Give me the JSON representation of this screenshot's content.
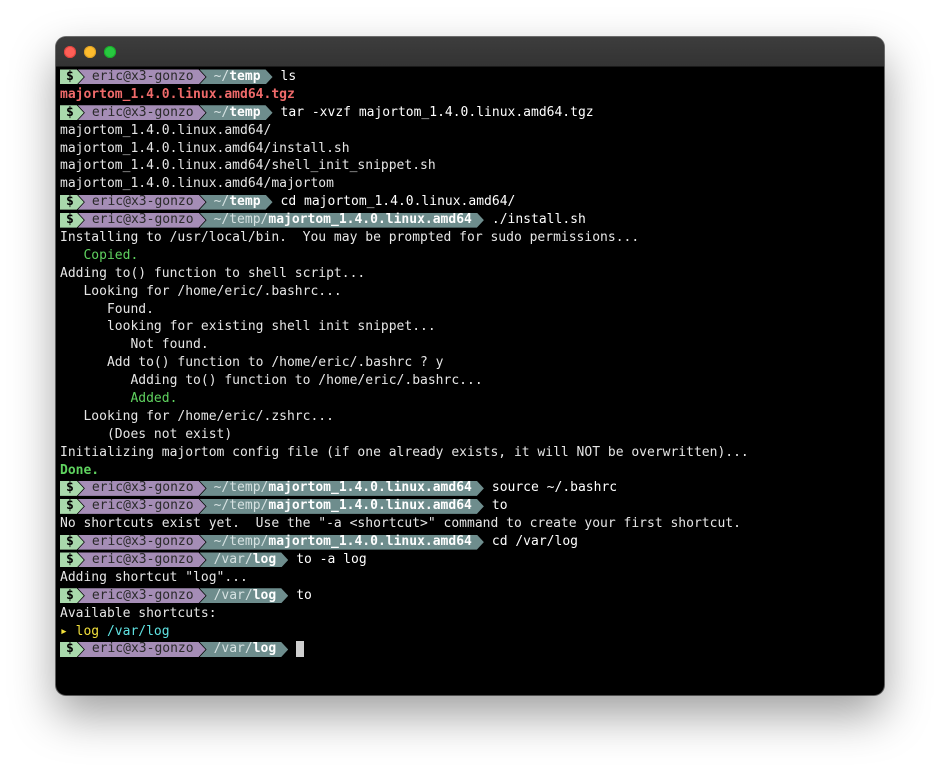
{
  "prompt": {
    "symbol": "$",
    "user": "eric@x3-gonzo",
    "tilde": "~/",
    "temp": "temp",
    "temp_prefix": "~/temp/",
    "dir": "majortom_1.4.0.linux.amd64",
    "var_prefix": "/var/",
    "log": "log"
  },
  "lines": {
    "l1_cmd": "ls",
    "l2_out": "majortom_1.4.0.linux.amd64.tgz",
    "l3_cmd": "tar -xvzf majortom_1.4.0.linux.amd64.tgz",
    "l4_out": "majortom_1.4.0.linux.amd64/",
    "l5_out": "majortom_1.4.0.linux.amd64/install.sh",
    "l6_out": "majortom_1.4.0.linux.amd64/shell_init_snippet.sh",
    "l7_out": "majortom_1.4.0.linux.amd64/majortom",
    "l8_cmd": "cd majortom_1.4.0.linux.amd64/",
    "l9_cmd": "./install.sh",
    "l10_out": "Installing to /usr/local/bin.  You may be prompted for sudo permissions...",
    "l11_out": "   Copied.",
    "l12_out": "Adding to() function to shell script...",
    "l13_out": "   Looking for /home/eric/.bashrc...",
    "l14_out": "      Found.",
    "l15_out": "      looking for existing shell init snippet...",
    "l16_out": "         Not found.",
    "l17_out": "      Add to() function to /home/eric/.bashrc ? y",
    "l18_out": "         Adding to() function to /home/eric/.bashrc...",
    "l19_out": "         Added.",
    "l20_out": "   Looking for /home/eric/.zshrc...",
    "l21_out": "      (Does not exist)",
    "l22_out": "Initializing majortom config file (if one already exists, it will NOT be overwritten)...",
    "l23_out": "Done.",
    "l24_cmd": "source ~/.bashrc",
    "l25_cmd": "to",
    "l26_out": "No shortcuts exist yet.  Use the \"-a <shortcut>\" command to create your first shortcut.",
    "l27_cmd": "cd /var/log",
    "l28_cmd": "to -a log",
    "l29_out": "Adding shortcut \"log\"...",
    "l30_cmd": "to",
    "l31_out": "Available shortcuts:",
    "l32_arrow": "▸",
    "l32_name": "log",
    "l32_path": "/var/log"
  }
}
